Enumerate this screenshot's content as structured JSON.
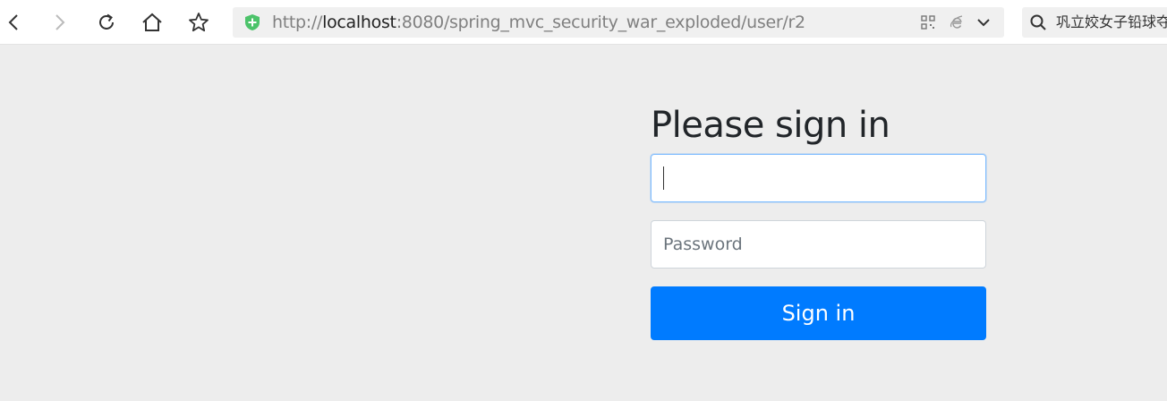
{
  "browser": {
    "url_prefix": "http://",
    "url_host": "localhost",
    "url_rest": ":8080/spring_mvc_security_war_exploded/user/r2",
    "search_text": "巩立姣女子铅球夺",
    "icons": {
      "back": "back-arrow-icon",
      "forward": "forward-arrow-icon",
      "reload": "reload-icon",
      "home": "home-icon",
      "favorite": "star-icon",
      "security": "shield-icon",
      "qr": "qr-code-icon",
      "ie_mode": "ie-icon",
      "dropdown": "chevron-down-icon",
      "search": "search-icon"
    },
    "colors": {
      "shield": "#4cc36a"
    }
  },
  "form": {
    "heading": "Please sign in",
    "username": {
      "value": "",
      "placeholder": ""
    },
    "password": {
      "value": "",
      "placeholder": "Password"
    },
    "submit_label": "Sign in",
    "colors": {
      "primary": "#007bff",
      "focus_border": "#80bdff"
    }
  }
}
